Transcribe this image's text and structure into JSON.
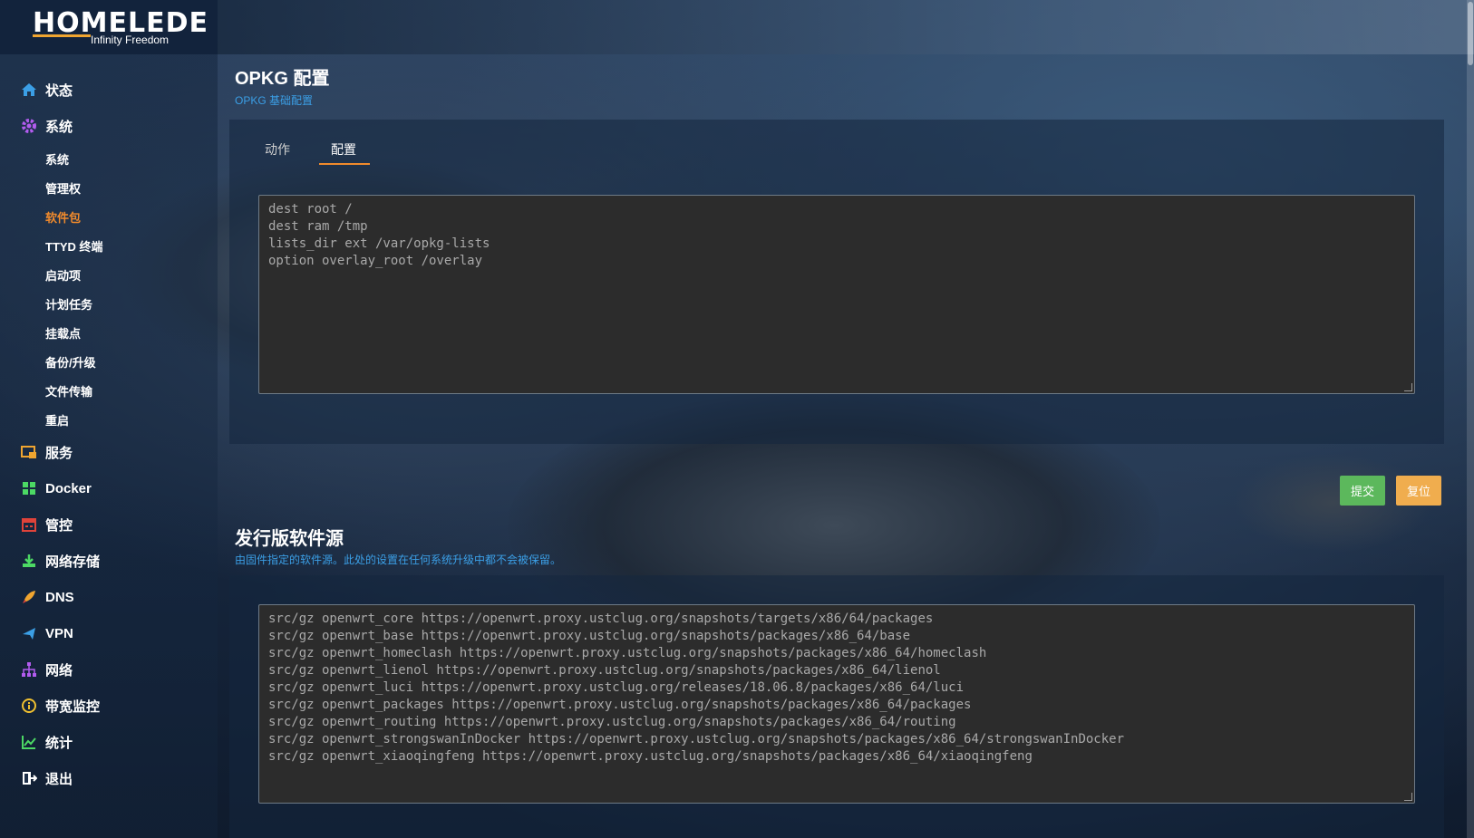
{
  "brand": {
    "name": "HOMELEDE",
    "tagline": "Infinity Freedom"
  },
  "colors": {
    "accent": "#f08a2c",
    "link": "#3b9fe6",
    "submit": "#5cb85c",
    "reset": "#f0ad4e"
  },
  "sidebar": {
    "items": [
      {
        "label": "状态",
        "icon": "home-icon"
      },
      {
        "label": "系统",
        "icon": "gear-icon"
      },
      {
        "label": "服务",
        "icon": "services-icon"
      },
      {
        "label": "Docker",
        "icon": "docker-icon"
      },
      {
        "label": "管控",
        "icon": "calendar-icon"
      },
      {
        "label": "网络存储",
        "icon": "download-icon"
      },
      {
        "label": "DNS",
        "icon": "rocket-icon"
      },
      {
        "label": "VPN",
        "icon": "plane-icon"
      },
      {
        "label": "网络",
        "icon": "network-icon"
      },
      {
        "label": "带宽监控",
        "icon": "info-circle-icon"
      },
      {
        "label": "统计",
        "icon": "chart-icon"
      },
      {
        "label": "退出",
        "icon": "logout-icon"
      }
    ],
    "system_sub": [
      {
        "label": "系统"
      },
      {
        "label": "管理权"
      },
      {
        "label": "软件包",
        "active": true
      },
      {
        "label": "TTYD 终端"
      },
      {
        "label": "启动项"
      },
      {
        "label": "计划任务"
      },
      {
        "label": "挂载点"
      },
      {
        "label": "备份/升级"
      },
      {
        "label": "文件传输"
      },
      {
        "label": "重启"
      }
    ]
  },
  "main": {
    "title": "OPKG 配置",
    "description": "OPKG 基础配置",
    "tabs": [
      {
        "label": "动作"
      },
      {
        "label": "配置",
        "active": true
      }
    ],
    "config_lines": [
      "dest root /",
      "dest ram /tmp",
      "lists_dir ext /var/opkg-lists",
      "option overlay_root /overlay"
    ],
    "submit_label": "提交",
    "reset_label": "复位",
    "feeds_title": "发行版软件源",
    "feeds_description": "由固件指定的软件源。此处的设置在任何系统升级中都不会被保留。",
    "feeds_lines": [
      "src/gz openwrt_core https://openwrt.proxy.ustclug.org/snapshots/targets/x86/64/packages",
      "src/gz openwrt_base https://openwrt.proxy.ustclug.org/snapshots/packages/x86_64/base",
      "src/gz openwrt_homeclash https://openwrt.proxy.ustclug.org/snapshots/packages/x86_64/homeclash",
      "src/gz openwrt_lienol https://openwrt.proxy.ustclug.org/snapshots/packages/x86_64/lienol",
      "src/gz openwrt_luci https://openwrt.proxy.ustclug.org/releases/18.06.8/packages/x86_64/luci",
      "src/gz openwrt_packages https://openwrt.proxy.ustclug.org/snapshots/packages/x86_64/packages",
      "src/gz openwrt_routing https://openwrt.proxy.ustclug.org/snapshots/packages/x86_64/routing",
      "src/gz openwrt_strongswanInDocker https://openwrt.proxy.ustclug.org/snapshots/packages/x86_64/strongswanInDocker",
      "src/gz openwrt_xiaoqingfeng https://openwrt.proxy.ustclug.org/snapshots/packages/x86_64/xiaoqingfeng"
    ]
  }
}
